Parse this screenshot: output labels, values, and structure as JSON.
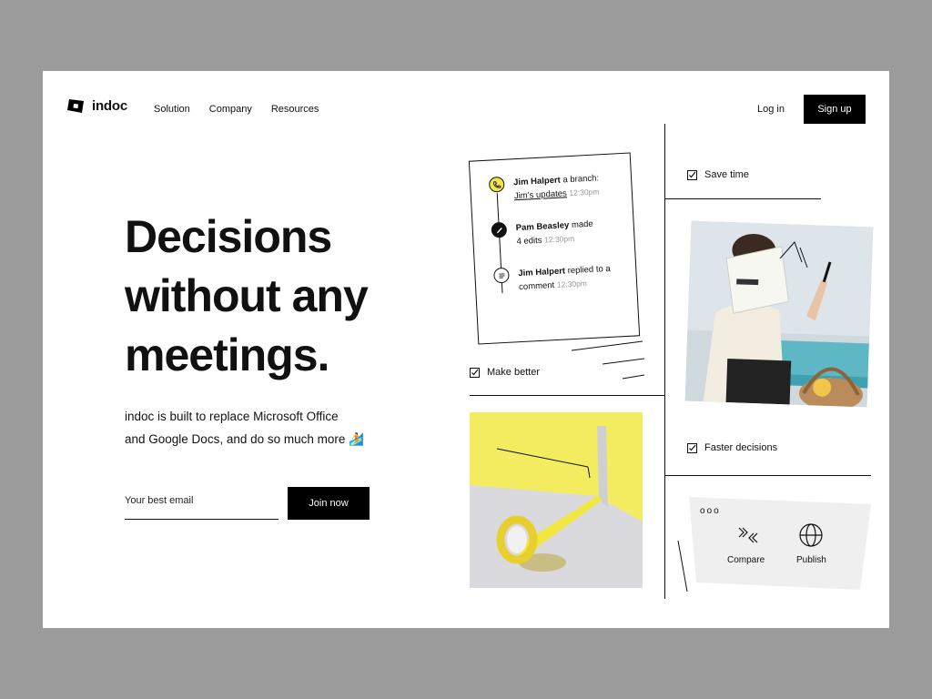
{
  "brand": {
    "name": "indoc"
  },
  "nav": {
    "items": [
      "Solution",
      "Company",
      "Resources"
    ],
    "login": "Log in",
    "signup": "Sign up"
  },
  "hero": {
    "headline": [
      "Decisions",
      "without any",
      "meetings."
    ],
    "sub_line1": "indoc is built to replace Microsoft Office",
    "sub_line2": "and Google Docs, and do so much more 🏄",
    "email_placeholder": "Your best email",
    "join_label": "Join now"
  },
  "activity": [
    {
      "name": "Jim Halpert",
      "action": "a branch:",
      "link": "Jim’s updates",
      "time": "12:30pm",
      "icon": "phone-icon"
    },
    {
      "name": "Pam Beasley",
      "action": "made",
      "detail": "4 edits",
      "time": "12:30pm",
      "icon": "pencil-icon"
    },
    {
      "name": "Jim Halpert",
      "action": "replied to a",
      "detail": "comment",
      "time": "12:30pm",
      "icon": "comment-icon"
    }
  ],
  "features": {
    "save_time": "Save time",
    "make_better": "Make better",
    "faster_decisions": "Faster decisions"
  },
  "tools": {
    "compare": "Compare",
    "publish": "Publish",
    "dots": "ooo"
  },
  "colors": {
    "accent": "#f2e64a",
    "dark": "#000000",
    "panel": "#efefef"
  }
}
